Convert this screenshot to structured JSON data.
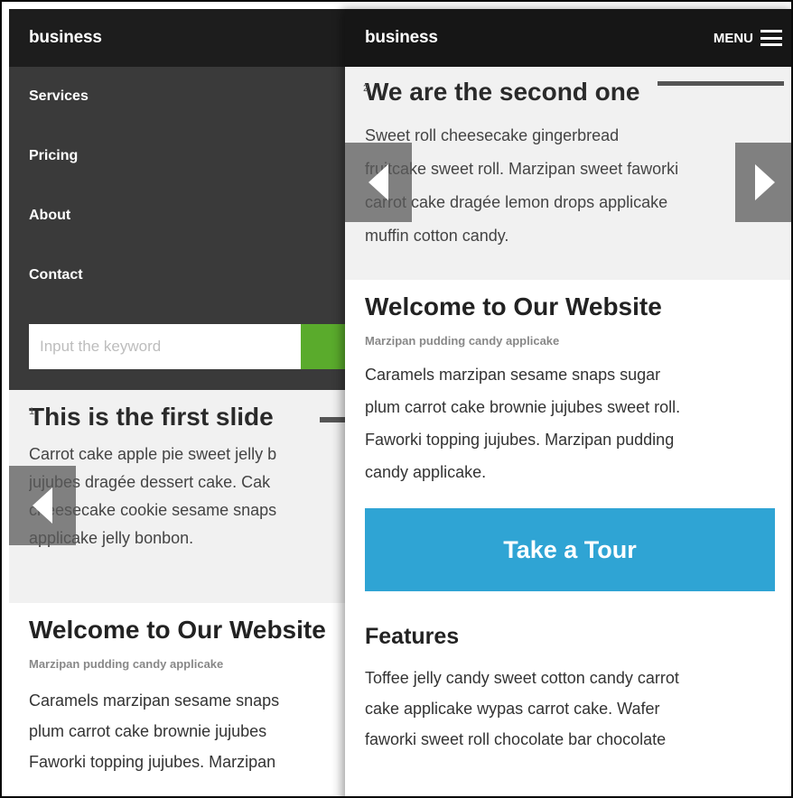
{
  "left": {
    "brand": "business",
    "nav": [
      "Services",
      "Pricing",
      "About",
      "Contact"
    ],
    "search": {
      "placeholder": "Input the keyword"
    },
    "slide": {
      "number": "1",
      "title": "This is the first slide",
      "lines": [
        "Carrot cake apple pie sweet jelly b",
        "jujubes dragée dessert cake. Cak",
        "cheesecake cookie sesame snaps",
        "applicake jelly bonbon."
      ]
    },
    "welcome": {
      "title": "Welcome to Our Website",
      "subtitle": "Marzipan pudding candy applicake",
      "lines": [
        "Caramels marzipan sesame snaps",
        "plum carrot cake brownie jujubes",
        "Faworki topping jujubes. Marzipan"
      ]
    }
  },
  "right": {
    "brand": "business",
    "menu_label": "MENU",
    "slide": {
      "number": "2",
      "title": "We are the second one",
      "lines": [
        "Sweet roll cheesecake gingerbread",
        "fruitcake sweet roll. Marzipan sweet faworki",
        "carrot cake dragée lemon drops applicake",
        "muffin cotton candy."
      ]
    },
    "welcome": {
      "title": "Welcome to Our Website",
      "subtitle": "Marzipan pudding candy applicake",
      "lines": [
        "Caramels marzipan sesame snaps sugar",
        "plum carrot cake brownie jujubes sweet roll.",
        "Faworki topping jujubes. Marzipan pudding",
        "candy applicake."
      ]
    },
    "cta_label": "Take a Tour",
    "features": {
      "title": "Features",
      "lines": [
        "Toffee jelly candy sweet cotton candy carrot",
        "cake applicake wypas carrot cake. Wafer",
        "faworki sweet roll chocolate bar chocolate"
      ]
    }
  },
  "colors": {
    "topbar": "#1d1d1d",
    "nav_bg": "#3a3a3a",
    "search_button": "#5aab2c",
    "cta": "#2fa4d4",
    "slide_bg": "#f1f1f1"
  }
}
